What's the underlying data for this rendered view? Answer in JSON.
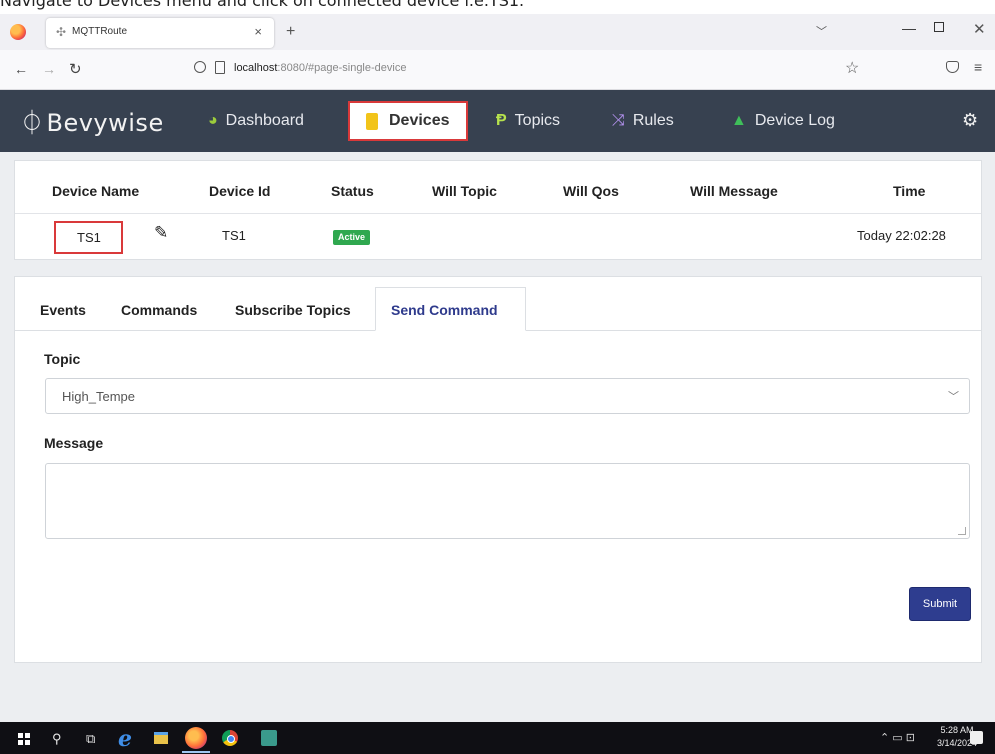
{
  "caption": "Navigate to Devices menu and click on connected device i.e.TS1.",
  "browser": {
    "tab_title": "MQTTRoute",
    "url_host": "localhost",
    "url_rest": ":8080/#page-single-device"
  },
  "app": {
    "brand": "Bevywise",
    "nav": {
      "dashboard": "Dashboard",
      "devices": "Devices",
      "topics": "Topics",
      "rules": "Rules",
      "device_log": "Device Log"
    }
  },
  "device_table": {
    "headers": [
      "Device Name",
      "Device Id",
      "Status",
      "Will Topic",
      "Will Qos",
      "Will Message",
      "Time"
    ],
    "row": {
      "name": "TS1",
      "id": "TS1",
      "status": "Active",
      "will_topic": "",
      "will_qos": "",
      "will_message": "",
      "time": "Today 22:02:28"
    }
  },
  "panel": {
    "tabs": [
      "Events",
      "Commands",
      "Subscribe Topics",
      "Send Command"
    ],
    "active_tab": "Send Command",
    "topic_label": "Topic",
    "topic_value": "High_Tempe",
    "message_label": "Message",
    "message_value": "",
    "submit_label": "Submit"
  },
  "taskbar": {
    "time": "5:28 AM",
    "date": "3/14/2024"
  },
  "colors": {
    "navbar": "#374150",
    "highlight_box": "#d9393a",
    "active_badge": "#2fa84f",
    "submit_button": "#2e3d8f",
    "active_tab_text": "#2e3a8c"
  }
}
